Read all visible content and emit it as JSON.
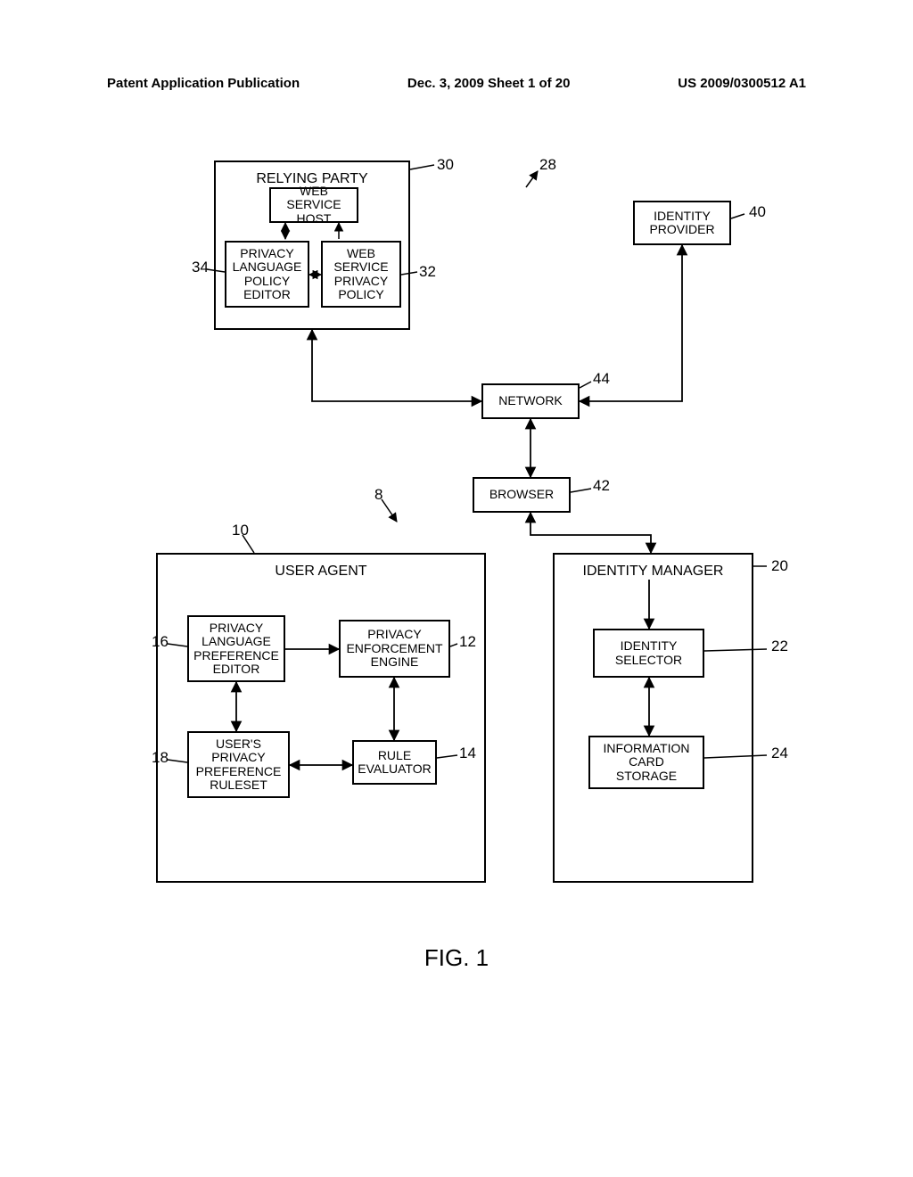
{
  "header": {
    "left": "Patent Application Publication",
    "center": "Dec. 3, 2009  Sheet 1 of 20",
    "right": "US 2009/0300512 A1"
  },
  "relyingParty": {
    "title": "RELYING PARTY",
    "host": "WEB SERVICE\nHOST",
    "editor": "PRIVACY\nLANGUAGE\nPOLICY\nEDITOR",
    "policy": "WEB\nSERVICE\nPRIVACY\nPOLICY"
  },
  "identityProvider": "IDENTITY\nPROVIDER",
  "network": "NETWORK",
  "browser": "BROWSER",
  "userAgent": {
    "title": "USER AGENT",
    "editor": "PRIVACY\nLANGUAGE\nPREFERENCE\nEDITOR",
    "engine": "PRIVACY\nENFORCEMENT\nENGINE",
    "ruleset": "USER'S\nPRIVACY\nPREFERENCE\nRULESET",
    "evaluator": "RULE\nEVALUATOR"
  },
  "identityManager": {
    "title": "IDENTITY MANAGER",
    "selector": "IDENTITY\nSELECTOR",
    "storage": "INFORMATION\nCARD\nSTORAGE"
  },
  "refs": {
    "r8": "8",
    "r10": "10",
    "r12": "12",
    "r14": "14",
    "r16": "16",
    "r18": "18",
    "r20": "20",
    "r22": "22",
    "r24": "24",
    "r28": "28",
    "r30": "30",
    "r32": "32",
    "r34": "34",
    "r40": "40",
    "r42": "42",
    "r44": "44"
  },
  "fig": "FIG. 1"
}
